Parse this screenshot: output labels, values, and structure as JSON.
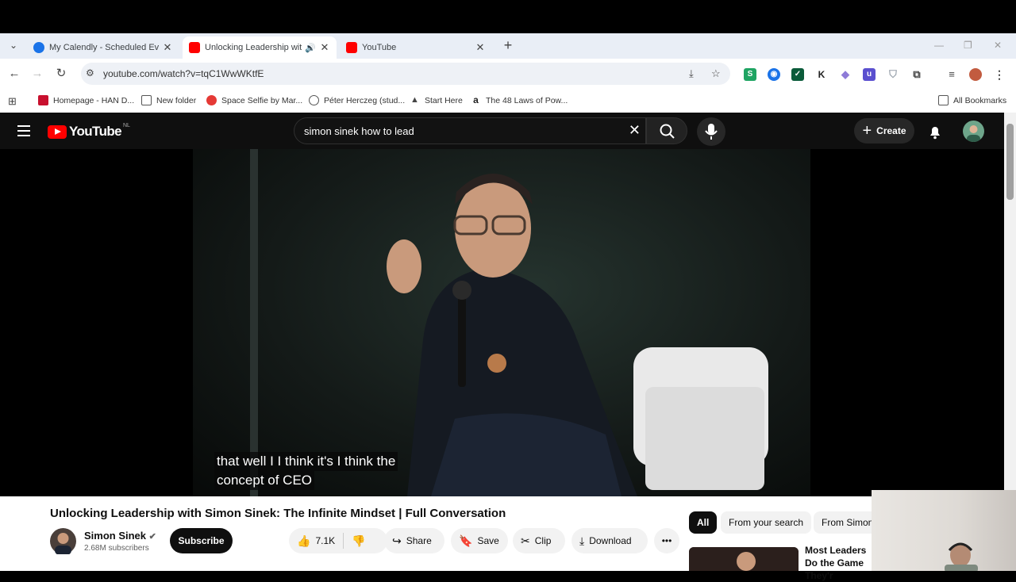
{
  "browser": {
    "tabs": [
      {
        "title": "My Calendly - Scheduled Events",
        "favicon_color": "#1a73e8",
        "active": false
      },
      {
        "title": "Unlocking Leadership with Simon Sinek",
        "favicon_color": "#ff0000",
        "active": true,
        "audio": true
      },
      {
        "title": "YouTube",
        "favicon_color": "#ff0000",
        "active": false
      }
    ],
    "url": "youtube.com/watch?v=tqC1WwWKtfE",
    "extensions": [
      {
        "label": "S",
        "color": "#1fa463"
      },
      {
        "label": "◉",
        "color": "#1a73e8"
      },
      {
        "label": "✓",
        "color": "#0b5b3a"
      },
      {
        "label": "K",
        "color": "#222222"
      },
      {
        "label": "◆",
        "color": "#8e7bd8"
      },
      {
        "label": "u",
        "color": "#5a4fcf"
      },
      {
        "label": "◈",
        "color": "#9aa3ad"
      }
    ],
    "bookmarks": [
      {
        "label": "Homepage - HAN D...",
        "color": "#c8102e"
      },
      {
        "label": "New folder",
        "color": "folder"
      },
      {
        "label": "Space Selfie by Mar...",
        "color": "#e53935"
      },
      {
        "label": "Péter Herczeg (stud...",
        "color": "globe"
      },
      {
        "label": "Start Here",
        "color": "triangle"
      },
      {
        "label": "The 48 Laws of Pow...",
        "color": "amazon"
      }
    ],
    "all_bookmarks": "All Bookmarks"
  },
  "youtube": {
    "logo_text": "YouTube",
    "region": "NL",
    "search_query": "simon sinek how to lead",
    "create_label": "Create",
    "caption_lines": [
      "that well I I think it's I think the",
      "concept of CEO"
    ],
    "video_title": "Unlocking Leadership with Simon Sinek: The Infinite Mindset | Full Conversation",
    "channel_name": "Simon Sinek",
    "subscribers": "2.68M subscribers",
    "subscribe_label": "Subscribe",
    "likes": "7.1K",
    "share_label": "Share",
    "save_label": "Save",
    "clip_label": "Clip",
    "download_label": "Download",
    "chips": [
      "All",
      "From your search",
      "From Simon"
    ],
    "recommended_title": "Most Leaders Do the Game They'r"
  }
}
